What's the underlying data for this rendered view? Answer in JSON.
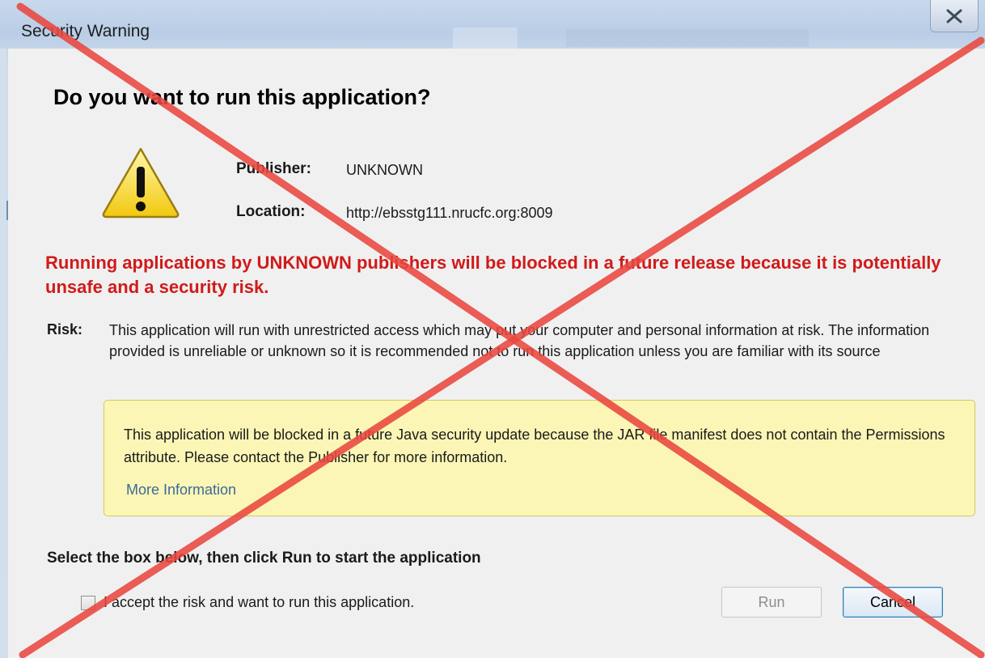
{
  "window": {
    "title": "Security Warning",
    "close_label": "X"
  },
  "dialog": {
    "question": "Do you want to run this application?",
    "publisher_label": "Publisher:",
    "publisher_value": "UNKNOWN",
    "location_label": "Location:",
    "location_value": "http://ebsstg111.nrucfc.org:8009",
    "warning": "Running applications by UNKNOWN publishers will be blocked in a future release because it is potentially unsafe and a security risk.",
    "risk_label": "Risk:",
    "risk_text": "This application will run with unrestricted access which may put your computer and personal information at risk. The information provided is unreliable or unknown so it is recommended not to run this application unless you are familiar with its source",
    "info_text": "This application will be blocked in a future Java security update because the JAR file manifest does not contain the Permissions attribute. Please contact the Publisher for more information.",
    "more_info_link": "More Information",
    "select_instruction": "Select the box below, then click Run to start the application",
    "accept_checkbox_label": "I accept the risk and want to run this application.",
    "accept_checked": false,
    "run_button": "Run",
    "run_enabled": false,
    "cancel_button": "Cancel"
  },
  "colors": {
    "warning_red": "#d11a1a",
    "info_background": "#fbf6b6",
    "link_blue": "#3d6a9a",
    "overlay_x": "#e8473f"
  },
  "icons": [
    "warning-icon",
    "close-icon",
    "red-x-overlay"
  ]
}
